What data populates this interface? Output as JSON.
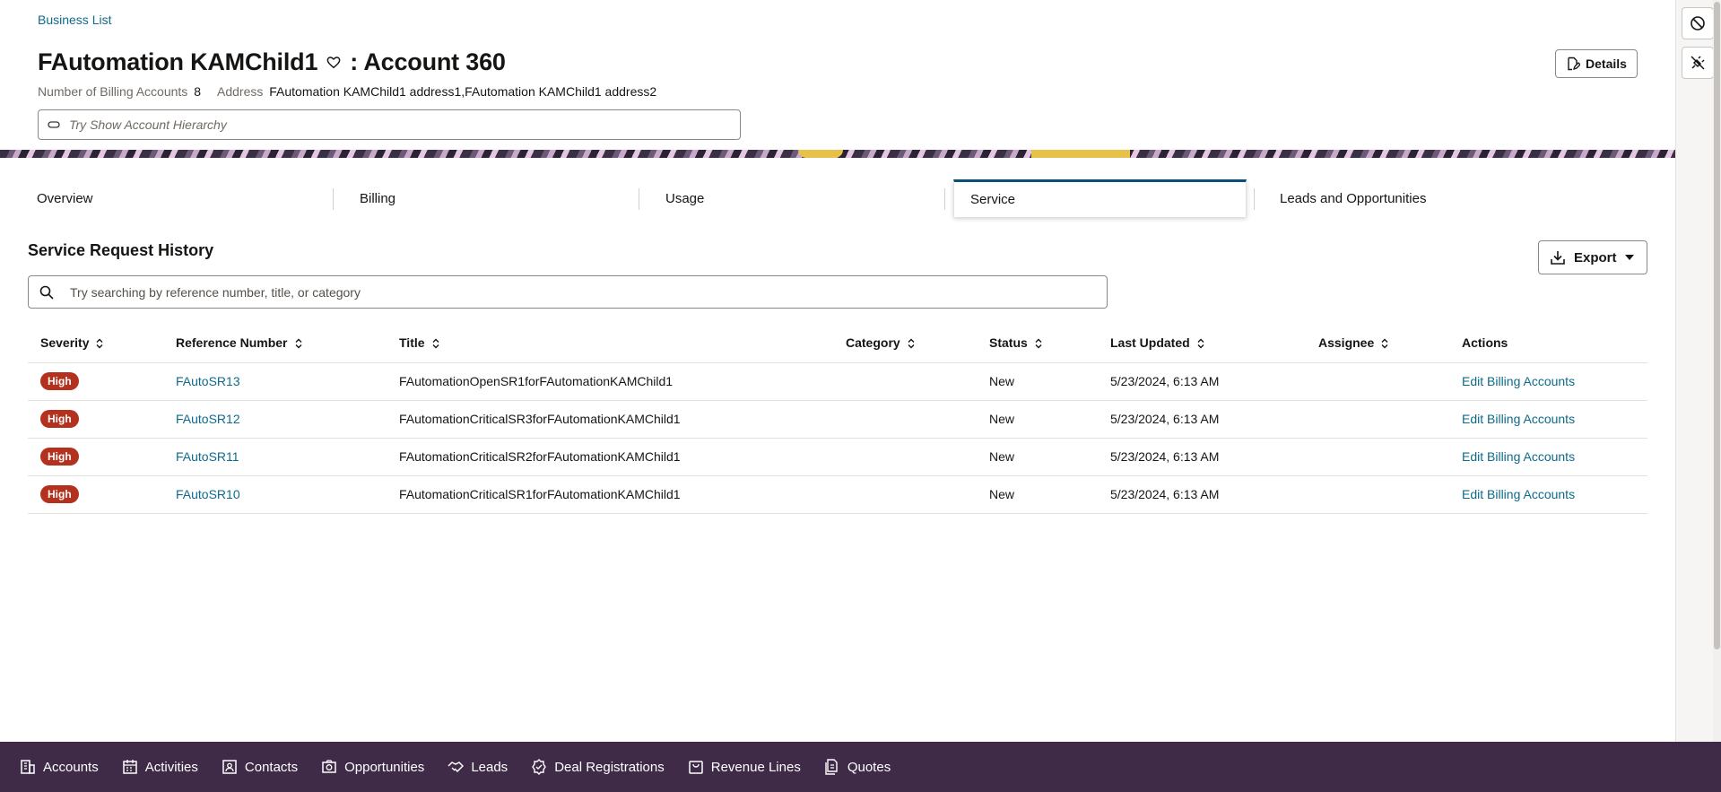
{
  "breadcrumb": {
    "label": "Business List"
  },
  "header": {
    "title_name": "FAutomation KAMChild1",
    "title_suffix": ": Account 360",
    "billing_accounts_label": "Number of Billing Accounts",
    "billing_accounts_value": "8",
    "address_label": "Address",
    "address_value": "FAutomation KAMChild1 address1,FAutomation KAMChild1 address2",
    "hierarchy_placeholder": "Try Show Account Hierarchy",
    "details_label": "Details"
  },
  "tabs": [
    {
      "label": "Overview",
      "active": false
    },
    {
      "label": "Billing",
      "active": false
    },
    {
      "label": "Usage",
      "active": false
    },
    {
      "label": "Service",
      "active": true
    },
    {
      "label": "Leads and Opportunities",
      "active": false
    }
  ],
  "section": {
    "title": "Service Request History",
    "export_label": "Export",
    "search_placeholder": "Try searching by reference number, title, or category"
  },
  "table": {
    "columns": [
      "Severity",
      "Reference Number",
      "Title",
      "Category",
      "Status",
      "Last Updated",
      "Assignee",
      "Actions"
    ],
    "rows": [
      {
        "severity": "High",
        "reference": "FAutoSR13",
        "title": "FAutomationOpenSR1forFAutomationKAMChild1",
        "category": "",
        "status": "New",
        "updated": "5/23/2024, 6:13 AM",
        "assignee": "",
        "action": "Edit Billing Accounts"
      },
      {
        "severity": "High",
        "reference": "FAutoSR12",
        "title": "FAutomationCriticalSR3forFAutomationKAMChild1",
        "category": "",
        "status": "New",
        "updated": "5/23/2024, 6:13 AM",
        "assignee": "",
        "action": "Edit Billing Accounts"
      },
      {
        "severity": "High",
        "reference": "FAutoSR11",
        "title": "FAutomationCriticalSR2forFAutomationKAMChild1",
        "category": "",
        "status": "New",
        "updated": "5/23/2024, 6:13 AM",
        "assignee": "",
        "action": "Edit Billing Accounts"
      },
      {
        "severity": "High",
        "reference": "FAutoSR10",
        "title": "FAutomationCriticalSR1forFAutomationKAMChild1",
        "category": "",
        "status": "New",
        "updated": "5/23/2024, 6:13 AM",
        "assignee": "",
        "action": "Edit Billing Accounts"
      }
    ]
  },
  "bottom_nav": [
    {
      "label": "Accounts",
      "icon": "building-icon"
    },
    {
      "label": "Activities",
      "icon": "calendar-icon"
    },
    {
      "label": "Contacts",
      "icon": "contact-card-icon"
    },
    {
      "label": "Opportunities",
      "icon": "opportunity-icon"
    },
    {
      "label": "Leads",
      "icon": "handshake-icon"
    },
    {
      "label": "Deal Registrations",
      "icon": "badge-check-icon"
    },
    {
      "label": "Revenue Lines",
      "icon": "bag-icon"
    },
    {
      "label": "Quotes",
      "icon": "documents-icon"
    }
  ],
  "colors": {
    "link": "#0f6a8b",
    "severity_high": "#b3311d",
    "bottom_nav_bg": "#3f2a47",
    "active_tab_accent": "#0a4f7a"
  }
}
